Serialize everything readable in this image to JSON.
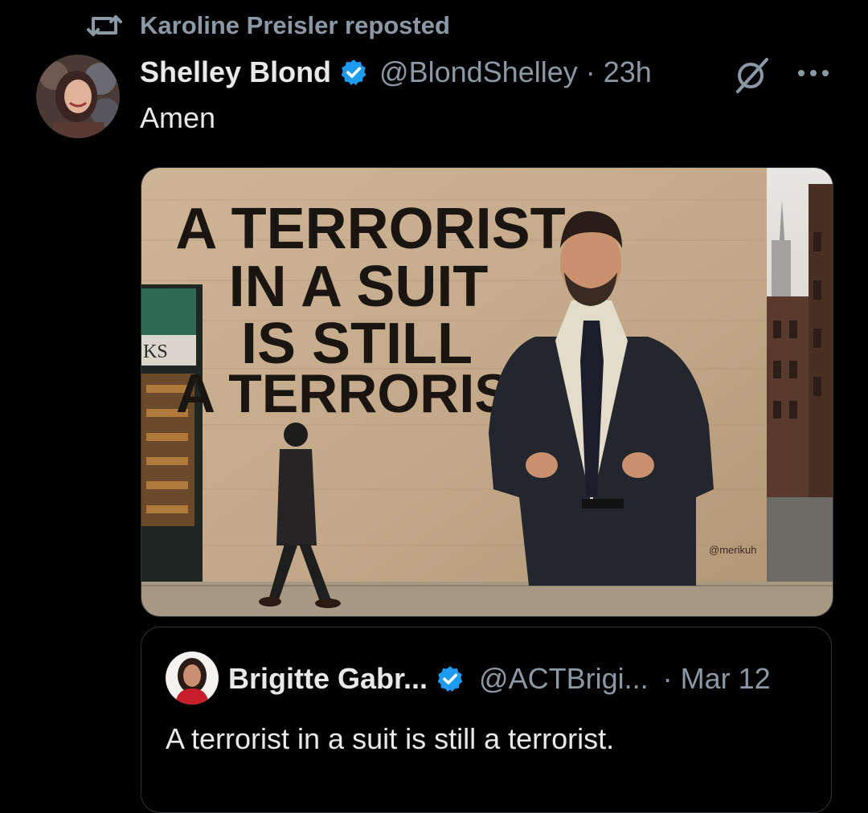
{
  "repost": {
    "label": "Karoline Preisler reposted",
    "icon": "repost-icon"
  },
  "tweet": {
    "author_name": "Shelley Blond",
    "handle": "@BlondShelley",
    "separator": "·",
    "time": "23h",
    "text": "Amen",
    "media": {
      "headline_lines": [
        "A TERRORIST",
        "IN A SUIT",
        "IS STILL",
        "A TERRORIST"
      ],
      "storefront_text": "KS",
      "signature": "@merikuh"
    }
  },
  "quoted": {
    "author_name": "Brigitte Gabr...",
    "handle": "@ACTBrigi...",
    "separator": "·",
    "time": "Mar 12",
    "text": "A terrorist in a suit is still a terrorist."
  },
  "colors": {
    "background": "#000000",
    "text": "#e7e9ea",
    "muted": "#8b98a5",
    "verified": "#1d9bf0",
    "border": "#2f3336"
  }
}
